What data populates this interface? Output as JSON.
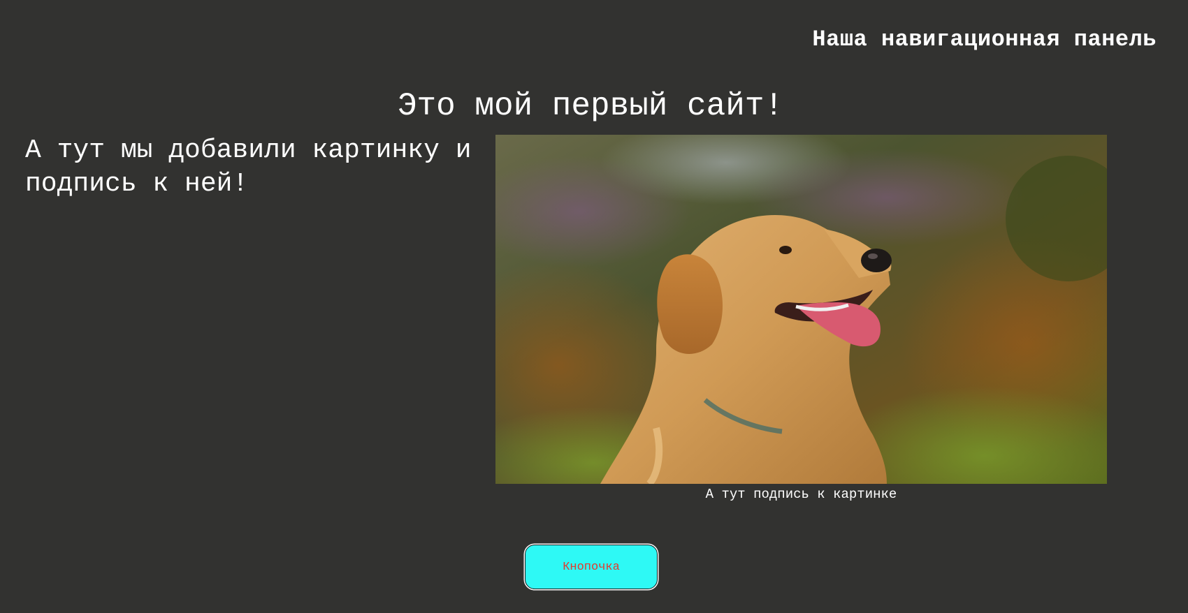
{
  "navbar": {
    "title": "Наша навигационная панель"
  },
  "main": {
    "title": "Это мой первый сайт!",
    "intro_text": "А тут мы добавили картинку и подпись к ней!"
  },
  "figure": {
    "image_subject": "golden retriever dog photo",
    "caption": "А тут подпись к картинке"
  },
  "button": {
    "label": "Кнопочка"
  },
  "colors": {
    "background": "#323230",
    "text": "#ffffff",
    "button_bg": "#2ef9f5",
    "button_text": "#e23a2e"
  }
}
